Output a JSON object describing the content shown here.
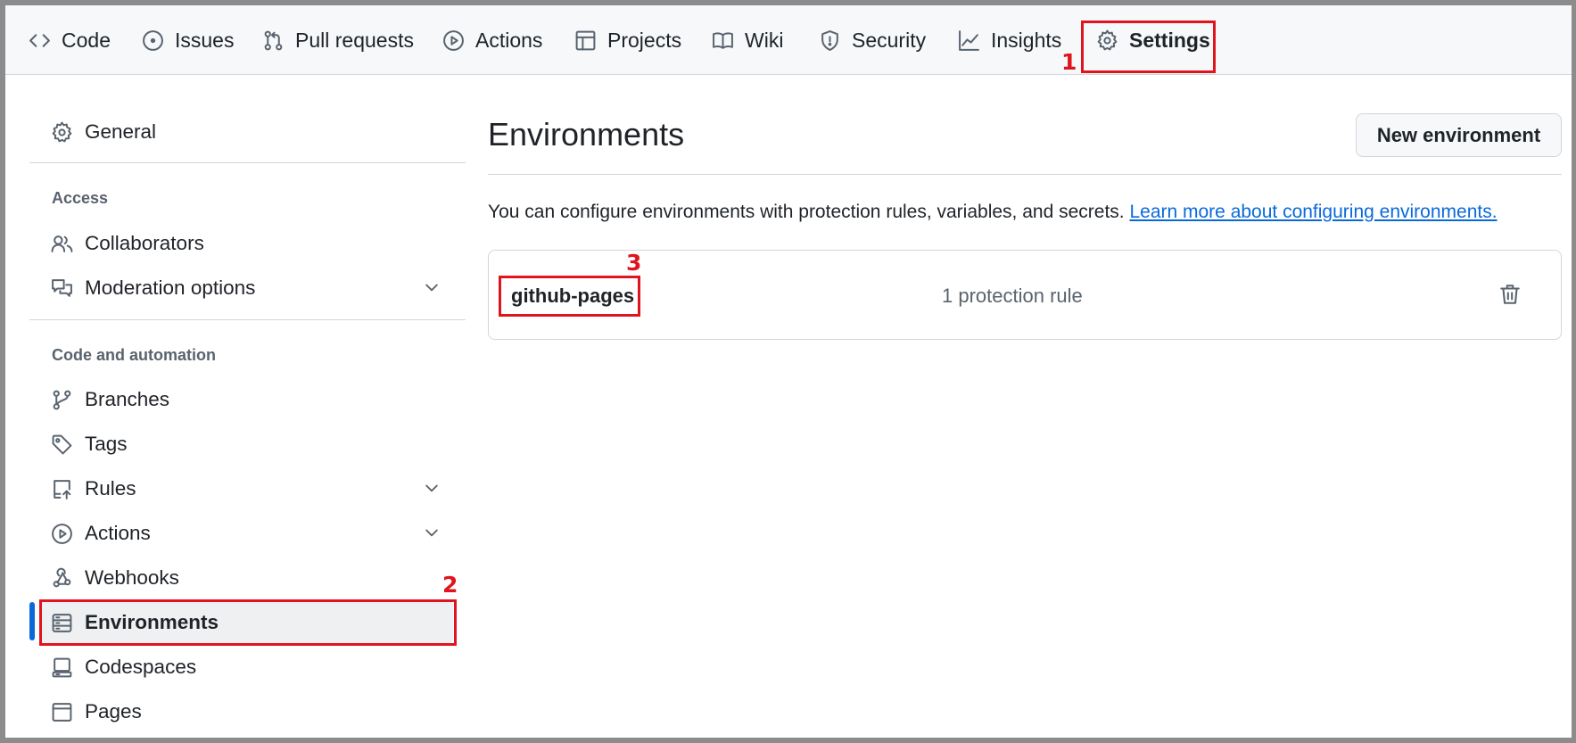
{
  "nav": {
    "tabs": [
      {
        "label": "Code",
        "icon": "code-icon"
      },
      {
        "label": "Issues",
        "icon": "issue-opened-icon"
      },
      {
        "label": "Pull requests",
        "icon": "git-pull-request-icon"
      },
      {
        "label": "Actions",
        "icon": "play-icon"
      },
      {
        "label": "Projects",
        "icon": "table-icon"
      },
      {
        "label": "Wiki",
        "icon": "book-icon"
      },
      {
        "label": "Security",
        "icon": "shield-icon"
      },
      {
        "label": "Insights",
        "icon": "graph-icon"
      },
      {
        "label": "Settings",
        "icon": "gear-icon",
        "active": true
      }
    ]
  },
  "sidebar": {
    "general": "General",
    "access_heading": "Access",
    "collaborators": "Collaborators",
    "moderation": "Moderation options",
    "code_heading": "Code and automation",
    "branches": "Branches",
    "tags": "Tags",
    "rules": "Rules",
    "actions": "Actions",
    "webhooks": "Webhooks",
    "environments": "Environments",
    "codespaces": "Codespaces",
    "pages": "Pages",
    "active_item": "Environments"
  },
  "main": {
    "title": "Environments",
    "new_button": "New environment",
    "description": "You can configure environments with protection rules, variables, and secrets.",
    "learn_more": "Learn more about configuring environments.",
    "environments": [
      {
        "name": "github-pages",
        "rules": "1 protection rule"
      }
    ]
  },
  "annotations": {
    "step1": "1",
    "step2": "2",
    "step3": "3"
  },
  "colors": {
    "accent": "#0969da",
    "annotation_red": "#e0141e"
  }
}
